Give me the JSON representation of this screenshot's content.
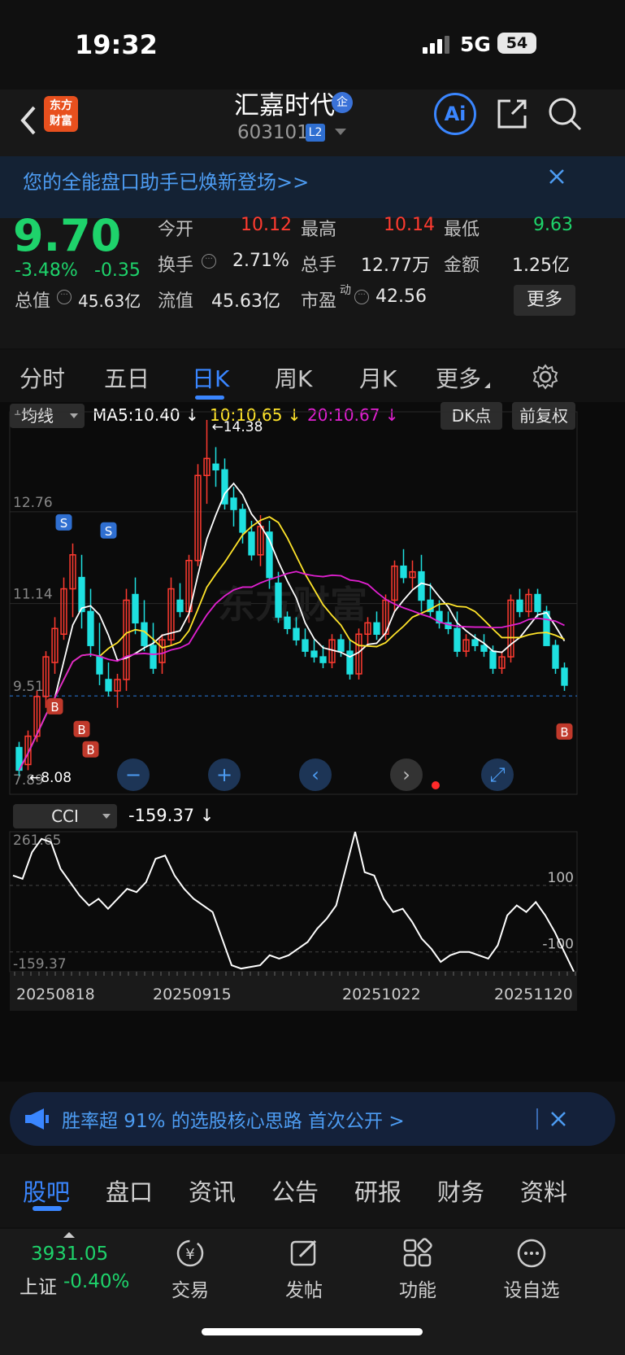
{
  "status": {
    "time": "19:32",
    "network": "5G",
    "battery": "54"
  },
  "header": {
    "logo_line1": "东方",
    "logo_line2": "财富",
    "stock_name": "汇嘉时代",
    "stock_badge": "企",
    "stock_code": "603101",
    "level_badge": "L2",
    "ai_label": "Ai"
  },
  "banner": {
    "text": "您的全能盘口助手已焕新登场>>"
  },
  "quote": {
    "price": "9.70",
    "change_pct": "-3.48%",
    "change": "-0.35",
    "open_label": "今开",
    "open": "10.12",
    "high_label": "最高",
    "high": "10.14",
    "low_label": "最低",
    "low": "9.63",
    "turnover_label": "换手",
    "turnover": "2.71%",
    "volume_label": "总手",
    "volume": "12.77万",
    "amount_label": "金额",
    "amount": "1.25亿",
    "mktcap_label": "总值",
    "mktcap": "45.63亿",
    "float_label": "流值",
    "float": "45.63亿",
    "pe_label": "市盈",
    "pe_sup": "动",
    "pe": "42.56",
    "more_label": "更多"
  },
  "tabs": [
    "分时",
    "五日",
    "日K",
    "周K",
    "月K",
    "更多"
  ],
  "chart": {
    "indicator_select": "均线",
    "ma5": "MA5:10.40",
    "ma10": "10:10.65",
    "ma20": "20:10.67",
    "dk_button": "DK点",
    "adjust_button": "前复权",
    "y_labels": [
      "14.38",
      "12.76",
      "11.14",
      "9.51",
      "7.89"
    ],
    "max_marker": "14.38",
    "min_marker": "8.08",
    "current_price_line": "9.51",
    "sub_indicator": "CCI",
    "cci_value": "-159.37",
    "cci_top": "261.65",
    "cci_bottom": "-159.37",
    "cci_levels": [
      "100",
      "-100"
    ],
    "dates": [
      "20250818",
      "20250915",
      "20251022",
      "20251120"
    ],
    "watermark": "东方财富"
  },
  "colors": {
    "up": "#ff3b30",
    "down": "#1ee0e0",
    "ma5": "#ffffff",
    "ma10": "#ffe42a",
    "ma20": "#e020d0",
    "accent": "#2b7be0"
  },
  "promo": {
    "text": "胜率超 91% 的选股核心思路 首次公开 >"
  },
  "subtabs": [
    "股吧",
    "盘口",
    "资讯",
    "公告",
    "研报",
    "财务",
    "资料"
  ],
  "bottom": {
    "index_value": "3931.05",
    "index_name": "上证",
    "index_change": "-0.40%",
    "trade": "交易",
    "post": "发帖",
    "function": "功能",
    "watchlist": "设自选"
  }
}
